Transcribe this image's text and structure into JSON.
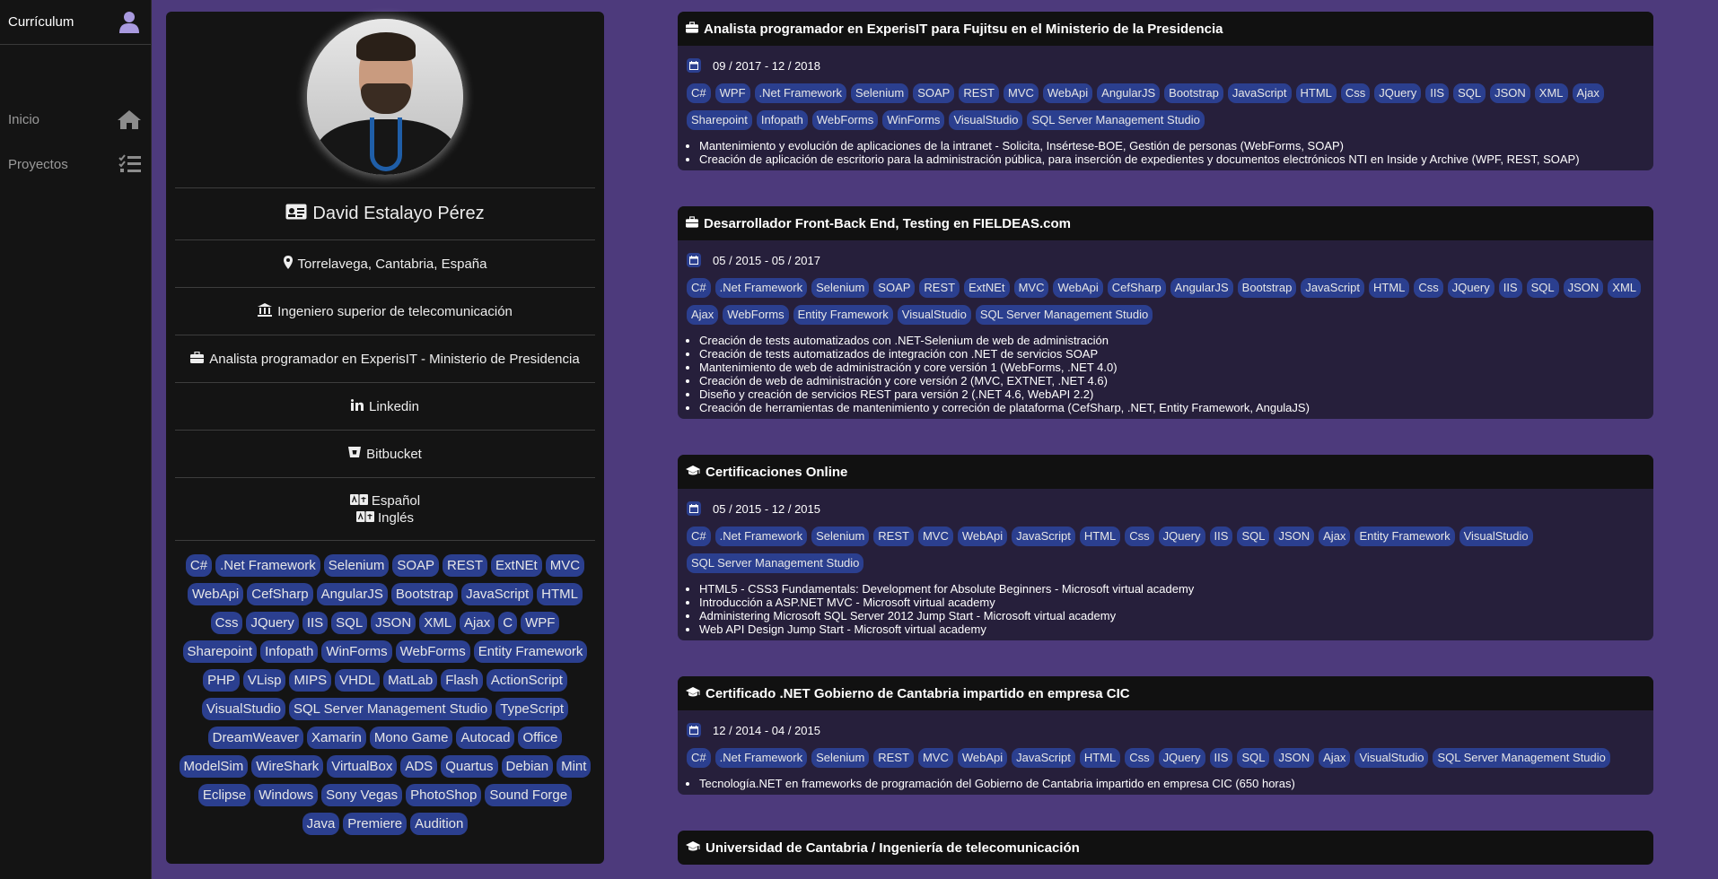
{
  "sidebar": {
    "brand": "Currículum",
    "items": [
      {
        "label": "Inicio",
        "icon": "home-icon"
      },
      {
        "label": "Proyectos",
        "icon": "tasks-icon"
      }
    ]
  },
  "profile": {
    "name": "David Estalayo Pérez",
    "location": "Torrelavega, Cantabria, España",
    "degree": "Ingeniero superior de telecomunicación",
    "job": "Analista programador en ExperisIT - Ministerio de Presidencia",
    "linkedin": "Linkedin",
    "bitbucket": "Bitbucket",
    "languages": [
      "Español",
      "Inglés"
    ],
    "skills": [
      "C#",
      ".Net Framework",
      "Selenium",
      "SOAP",
      "REST",
      "ExtNEt",
      "MVC",
      "WebApi",
      "CefSharp",
      "AngularJS",
      "Bootstrap",
      "JavaScript",
      "HTML",
      "Css",
      "JQuery",
      "IIS",
      "SQL",
      "JSON",
      "XML",
      "Ajax",
      "C",
      "WPF",
      "Sharepoint",
      "Infopath",
      "WinForms",
      "WebForms",
      "Entity Framework",
      "PHP",
      "VLisp",
      "MIPS",
      "VHDL",
      "MatLab",
      "Flash",
      "ActionScript",
      "VisualStudio",
      "SQL Server Management Studio",
      "TypeScript",
      "DreamWeaver",
      "Xamarin",
      "Mono Game",
      "Autocad",
      "Office",
      "ModelSim",
      "WireShark",
      "VirtualBox",
      "ADS",
      "Quartus",
      "Debian",
      "Mint",
      "Eclipse",
      "Windows",
      "Sony Vegas",
      "PhotoShop",
      "Sound Forge",
      "Java",
      "Premiere",
      "Audition"
    ]
  },
  "experience": [
    {
      "icon": "briefcase-icon",
      "title": "Analista programador en ExperisIT para Fujitsu en el Ministerio de la Presidencia",
      "dates": "09 / 2017 - 12 / 2018",
      "tags": [
        "C#",
        "WPF",
        ".Net Framework",
        "Selenium",
        "SOAP",
        "REST",
        "MVC",
        "WebApi",
        "AngularJS",
        "Bootstrap",
        "JavaScript",
        "HTML",
        "Css",
        "JQuery",
        "IIS",
        "SQL",
        "JSON",
        "XML",
        "Ajax",
        "Sharepoint",
        "Infopath",
        "WebForms",
        "WinForms",
        "VisualStudio",
        "SQL Server Management Studio"
      ],
      "bullets": [
        "Mantenimiento y evolución de aplicaciones de la intranet - Solicita, Insértese-BOE, Gestión de personas (WebForms, SOAP)",
        "Creación de aplicación de escritorio para la administración pública, para inserción de expedientes y documentos electrónicos NTI en Inside y Archive (WPF, REST, SOAP)"
      ]
    },
    {
      "icon": "briefcase-icon",
      "title": "Desarrollador Front-Back End, Testing en FIELDEAS.com",
      "dates": "05 / 2015 - 05 / 2017",
      "tags": [
        "C#",
        ".Net Framework",
        "Selenium",
        "SOAP",
        "REST",
        "ExtNEt",
        "MVC",
        "WebApi",
        "CefSharp",
        "AngularJS",
        "Bootstrap",
        "JavaScript",
        "HTML",
        "Css",
        "JQuery",
        "IIS",
        "SQL",
        "JSON",
        "XML",
        "Ajax",
        "WebForms",
        "Entity Framework",
        "VisualStudio",
        "SQL Server Management Studio"
      ],
      "bullets": [
        "Creación de tests automatizados con .NET-Selenium de web de administración",
        "Creación de tests automatizados de integración con .NET de servicios SOAP",
        "Mantenimiento de web de administración y core versión 1 (WebForms, .NET 4.0)",
        "Creación de web de administración y core versión 2 (MVC, EXTNET, .NET 4.6)",
        "Diseño y creación de servicios REST para versión 2 (.NET 4.6, WebAPI 2.2)",
        "Creación de herramientas de mantenimiento y correción de plataforma (CefSharp, .NET, Entity Framework, AngulaJS)"
      ]
    },
    {
      "icon": "graduation-cap-icon",
      "title": "Certificaciones Online",
      "dates": "05 / 2015 - 12 / 2015",
      "tags": [
        "C#",
        ".Net Framework",
        "Selenium",
        "REST",
        "MVC",
        "WebApi",
        "JavaScript",
        "HTML",
        "Css",
        "JQuery",
        "IIS",
        "SQL",
        "JSON",
        "Ajax",
        "Entity Framework",
        "VisualStudio",
        "SQL Server Management Studio"
      ],
      "bullets": [
        "HTML5 - CSS3 Fundamentals: Development for Absolute Beginners - Microsoft virtual academy",
        "Introducción a ASP.NET MVC - Microsoft virtual academy",
        "Administering Microsoft SQL Server 2012 Jump Start - Microsoft virtual academy",
        "Web API Design Jump Start - Microsoft virtual academy"
      ]
    },
    {
      "icon": "graduation-cap-icon",
      "title": "Certificado .NET Gobierno de Cantabria impartido en empresa CIC",
      "dates": "12 / 2014 - 04 / 2015",
      "tags": [
        "C#",
        ".Net Framework",
        "Selenium",
        "REST",
        "MVC",
        "WebApi",
        "JavaScript",
        "HTML",
        "Css",
        "JQuery",
        "IIS",
        "SQL",
        "JSON",
        "Ajax",
        "VisualStudio",
        "SQL Server Management Studio"
      ],
      "bullets": [
        "Tecnología.NET en frameworks de programación del Gobierno de Cantabria impartido en empresa CIC (650 horas)"
      ]
    },
    {
      "icon": "graduation-cap-icon",
      "title": "Universidad de Cantabria / Ingeniería de telecomunicación",
      "dates": "",
      "tags": [],
      "bullets": []
    }
  ]
}
